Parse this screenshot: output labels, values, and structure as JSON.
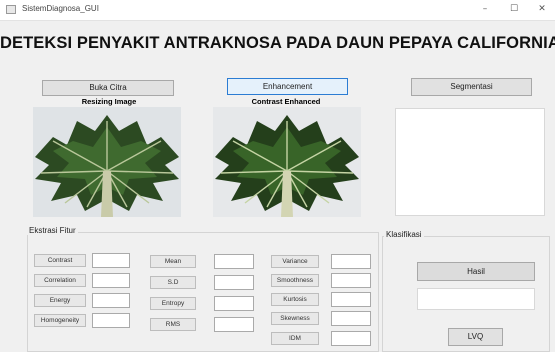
{
  "window": {
    "title": "SistemDiagnosa_GUI",
    "min": "–",
    "max": "☐",
    "close": "✕"
  },
  "heading": "DETEKSI PENYAKIT ANTRAKNOSA PADA DAUN PEPAYA CALIFORNIA",
  "buttons": {
    "open_image": "Buka Citra",
    "enhancement": "Enhancement",
    "segmentation": "Segmentasi",
    "result": "Hasil",
    "lvq": "LVQ"
  },
  "images": {
    "resize_caption": "Resizing Image",
    "contrast_caption": "Contrast Enhanced"
  },
  "feature_panel": {
    "title": "Ekstrasi Fitur",
    "col1": [
      {
        "label": "Contrast",
        "value": ""
      },
      {
        "label": "Correlation",
        "value": ""
      },
      {
        "label": "Energy",
        "value": ""
      },
      {
        "label": "Homogeneity",
        "value": ""
      }
    ],
    "col2": [
      {
        "label": "Mean",
        "value": ""
      },
      {
        "label": "S.D",
        "value": ""
      },
      {
        "label": "Entropy",
        "value": ""
      },
      {
        "label": "RMS",
        "value": ""
      }
    ],
    "col3": [
      {
        "label": "Variance",
        "value": ""
      },
      {
        "label": "Smoothness",
        "value": ""
      },
      {
        "label": "Kurtosis",
        "value": ""
      },
      {
        "label": "Skewness",
        "value": ""
      },
      {
        "label": "IDM",
        "value": ""
      }
    ]
  },
  "classification_panel": {
    "title": "Klasifikasi",
    "result_value": ""
  },
  "colors": {
    "leaf_dark": "#2c4a22",
    "leaf_mid": "#3f6a2f",
    "vein": "#b9c79a",
    "active_border": "#2b7cd3"
  }
}
